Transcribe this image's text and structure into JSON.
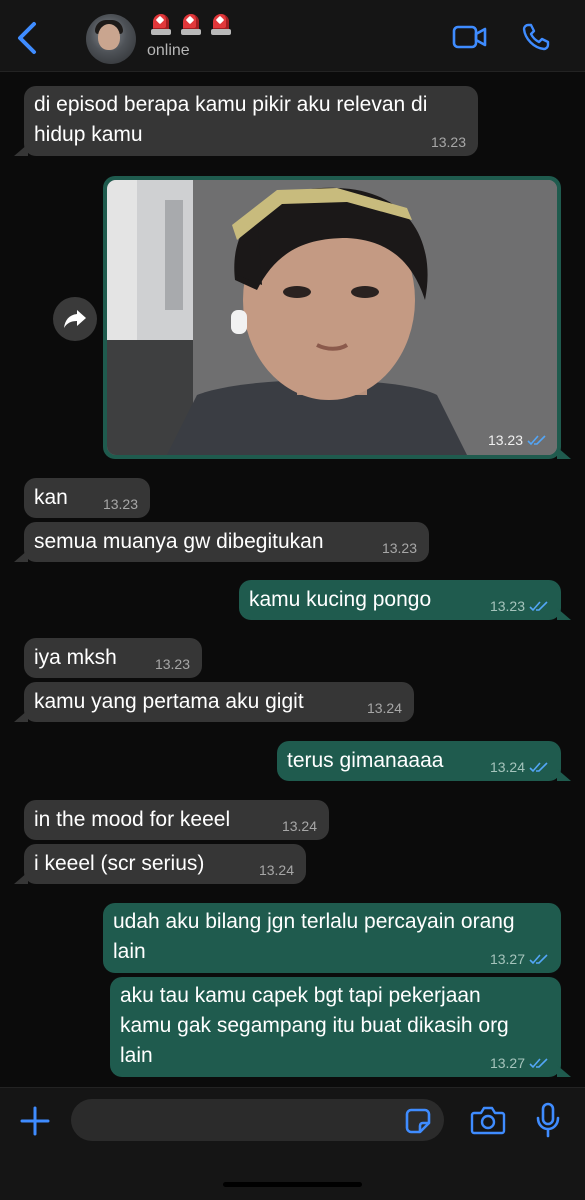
{
  "header": {
    "status": "online",
    "back_icon": "chevron-left-icon",
    "emoji_icons": [
      "police-light-icon",
      "police-light-icon",
      "police-light-icon"
    ],
    "video_icon": "video-camera-icon",
    "call_icon": "phone-icon"
  },
  "messages": [
    {
      "dir": "in",
      "lines": [
        "di episod berapa kamu pikir aku relevan di",
        "hidup kamu"
      ],
      "time": "13.23"
    },
    {
      "dir": "out",
      "type": "image",
      "time": "13.23",
      "read": true
    },
    {
      "dir": "in",
      "lines": [
        "kan"
      ],
      "time": "13.23"
    },
    {
      "dir": "in",
      "lines": [
        "semua muanya gw dibegitukan"
      ],
      "time": "13.23"
    },
    {
      "dir": "out",
      "lines": [
        "kamu kucing pongo"
      ],
      "time": "13.23",
      "read": true
    },
    {
      "dir": "in",
      "lines": [
        "iya mksh"
      ],
      "time": "13.23"
    },
    {
      "dir": "in",
      "lines": [
        "kamu yang pertama aku gigit"
      ],
      "time": "13.24"
    },
    {
      "dir": "out",
      "lines": [
        "terus gimanaaaa"
      ],
      "time": "13.24",
      "read": true
    },
    {
      "dir": "in",
      "lines": [
        "in the mood for keeel"
      ],
      "time": "13.24"
    },
    {
      "dir": "in",
      "lines": [
        "i keeel (scr serius)"
      ],
      "time": "13.24"
    },
    {
      "dir": "out",
      "lines": [
        "udah aku bilang jgn terlalu percayain orang",
        "lain"
      ],
      "time": "13.27",
      "read": true
    },
    {
      "dir": "out",
      "lines": [
        "aku tau kamu capek bgt tapi pekerjaan",
        "kamu gak segampang itu buat dikasih org",
        "lain"
      ],
      "time": "13.27",
      "read": true
    }
  ],
  "composer": {
    "placeholder": "",
    "plus_icon": "plus-icon",
    "sticker_icon": "sticker-icon",
    "camera_icon": "camera-icon",
    "mic_icon": "microphone-icon"
  },
  "colors": {
    "accent": "#3f8cff",
    "incoming_bubble": "#363636",
    "outgoing_bubble": "#1f5b4e",
    "read_ticks": "#53a6f7"
  }
}
